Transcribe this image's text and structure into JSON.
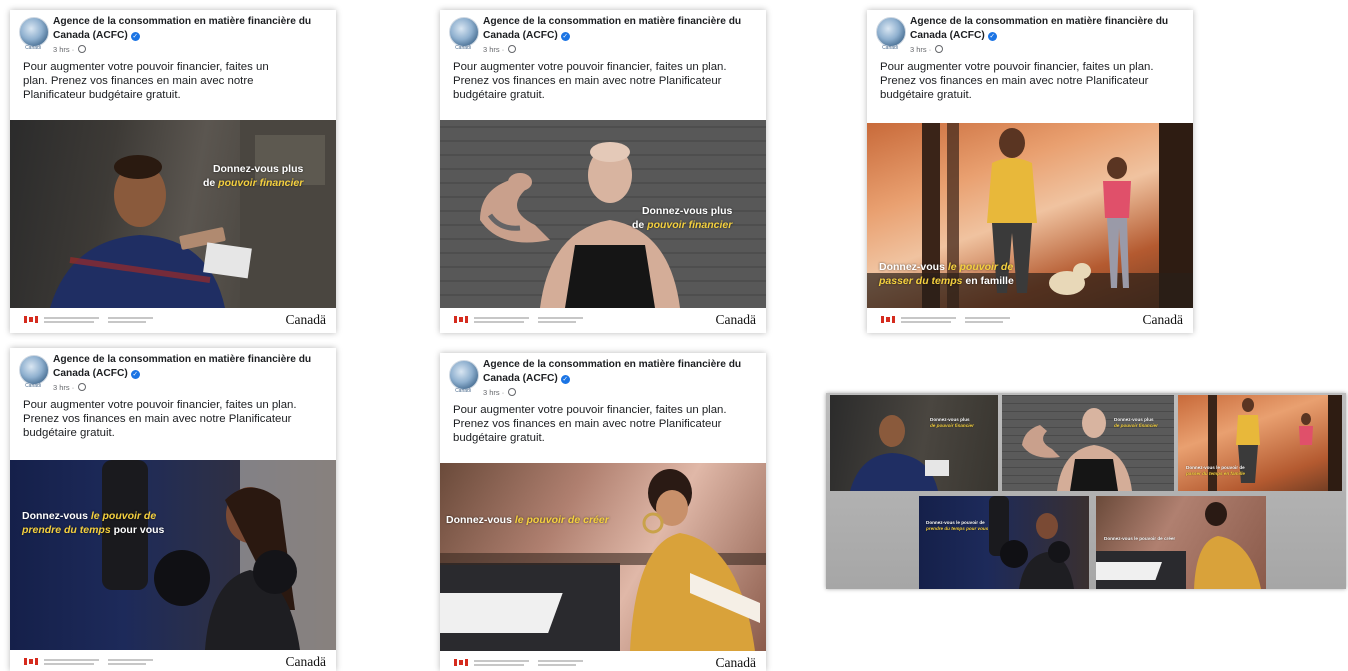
{
  "post": {
    "page_name": "Agence de la consommation en matière financière du Canada (ACFC)",
    "page_name_line1": "Agence de la consommation en matière financière du",
    "page_name_line2": "Canada (ACFC)",
    "avatar_tag": "Canadi",
    "timestamp": "3 hrs",
    "text": "Pour augmenter votre pouvoir financier, faites un plan. Prenez vos finances en main avec notre Planificateur budgétaire gratuit."
  },
  "footer": {
    "wordmark": "Canadä"
  },
  "cards": [
    {
      "overlay_pre": "Donnez-vous plus",
      "overlay_mid": "de ",
      "overlay_hl": "pouvoir financier",
      "overlay_post": ""
    },
    {
      "overlay_pre": "Donnez-vous plus",
      "overlay_mid": "de ",
      "overlay_hl": "pouvoir financier",
      "overlay_post": ""
    },
    {
      "overlay_pre": "Donnez-vous ",
      "overlay_hl": "le pouvoir de",
      "overlay_hl2": "passer du temps",
      "overlay_post": " en famille"
    },
    {
      "overlay_pre": "Donnez-vous ",
      "overlay_hl": "le pouvoir de",
      "overlay_hl2": "prendre du temps",
      "overlay_post": " pour vous"
    },
    {
      "overlay_pre": "Donnez-vous ",
      "overlay_hl": "le pouvoir de créer",
      "overlay_post": ""
    }
  ],
  "banner": {
    "tiles": [
      {
        "pre": "Donnez-vous plus",
        "hl": "de pouvoir financier"
      },
      {
        "pre": "Donnez-vous plus",
        "hl": "de pouvoir financier"
      },
      {
        "pre": "Donnez-vous le pouvoir de",
        "hl": "passer du temps en famille"
      },
      {
        "pre": "Donnez-vous le pouvoir de",
        "hl": "prendre du temps pour vous"
      },
      {
        "pre": "Donnez-vous le pouvoir de créer",
        "hl": ""
      }
    ]
  },
  "colors": {
    "accent_yellow": "#f4d03f",
    "verified_blue": "#1b74e4",
    "canada_red": "#d52b1e"
  },
  "icons": [
    "verified-badge-icon",
    "globe-icon",
    "canada-flag-icon"
  ]
}
